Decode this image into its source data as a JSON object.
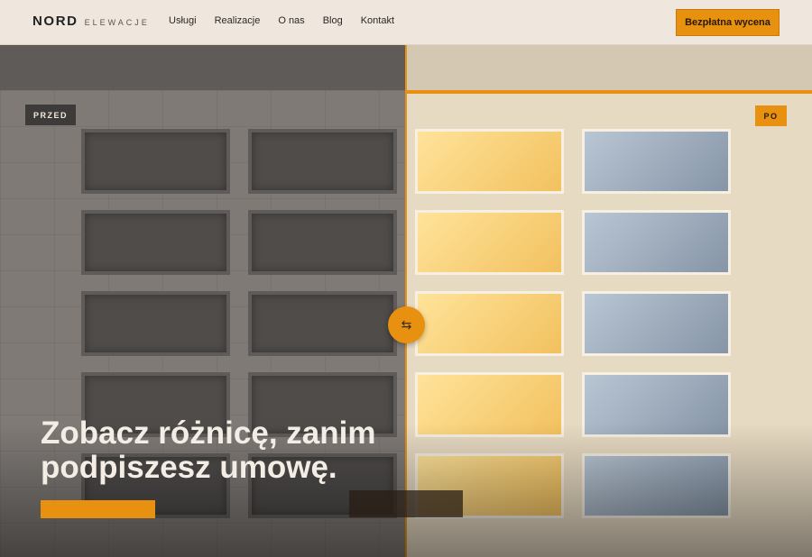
{
  "header": {
    "logo_main": "NORD",
    "logo_sub": "ELEWACJE",
    "nav": [
      "Usługi",
      "Realizacje",
      "O nas",
      "Blog",
      "Kontakt"
    ],
    "cta_label": "Bezpłatna wycena"
  },
  "hero": {
    "badge_before": "PRZED",
    "badge_after": "PO",
    "headline_line1": "Zobacz różnicę, zanim",
    "headline_line2": "podpiszesz umowę.",
    "handle_icon": "swap-arrows-icon"
  },
  "colors": {
    "accent": "#e8900f",
    "header_bg": "#efe7de",
    "before_bg": "#7f7a76",
    "after_bg": "#e7dac2"
  }
}
